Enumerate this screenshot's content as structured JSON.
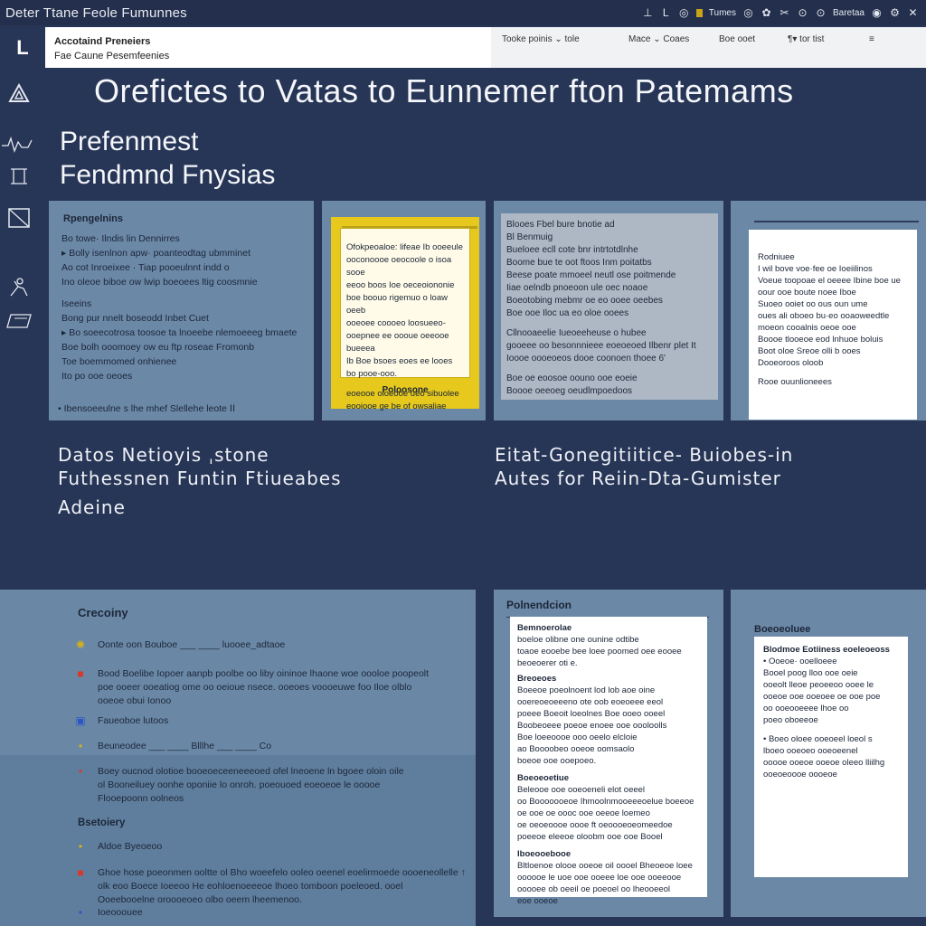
{
  "window": {
    "title": "Deter Ttane Feole Fumunnes",
    "controls": [
      {
        "icon": "underscore-icon",
        "glyph": "⊥"
      },
      {
        "icon": "eye-icon",
        "glyph": "L  ◎"
      },
      {
        "icon": "flag-icon",
        "glyph": ""
      },
      {
        "label": "Tumes"
      },
      {
        "icon": "target-icon",
        "glyph": "◎"
      },
      {
        "icon": "ring-icon",
        "glyph": "✿"
      },
      {
        "icon": "scissors-icon",
        "glyph": "✂"
      },
      {
        "icon": "circle-icon",
        "glyph": "⊙"
      },
      {
        "icon": "settings-icon",
        "glyph": "⊙"
      },
      {
        "label": "Baretaa"
      },
      {
        "icon": "globe-icon",
        "glyph": "◉"
      },
      {
        "icon": "gear-icon",
        "glyph": "⚙"
      },
      {
        "icon": "close-icon",
        "glyph": "✕"
      }
    ]
  },
  "menubar": {
    "logo": "L",
    "line1": "Accotaind Preneiers",
    "line2": "Fae Caune Pesemfeenies",
    "items": [
      "Tooke poinis ⌄ tole",
      "Mace ⌄ Coaes",
      "Boe  ooet",
      "¶▾  tor  tist",
      "≡"
    ]
  },
  "rail": [
    "triangle-icon",
    "pulse-icon",
    "frame-icon",
    "box-icon",
    "person-icon",
    "page-icon"
  ],
  "hero": {
    "title": "Orefictes to Vatas to Eunnemer fton Patemams"
  },
  "section": {
    "line1": "Prefenmest",
    "line2": "Fendmnd Fnysias"
  },
  "card1": {
    "head": "Rpengelnins",
    "lines": [
      "Bo towe·  Ilndis  lin  Dennirres",
      "▸ Bolly isenlnon apw·  poanteodtag ubmminet",
      "Ao cot Inroeixee ·  Tiap pooeulnnt indd o",
      "Ino oleoe biboe  ow lwip boeoees ltig coosmnie",
      "Iseeins",
      "Bong pur  nnelt boseodd Inbet Cuet",
      "▸ Bo soeecotrosa toosoe ta lnoeebe nlemoeeeg bmaete",
      "Boe bolh ooomoey  ow eu ftp roseae Fromonb",
      "Toe boemmomed onhienee",
      "Ito po ooe oeoes"
    ],
    "foot": "• Ibensoeeulne s lhe mhef Slellehe leote  ⅠⅠ"
  },
  "card2": {
    "lines": [
      "Ofokpeoaloe: lifeae Ib ooeeule",
      "ooconoooe oeocoole o isoa sooe",
      "eeoo boos Ioe oeceoiononie",
      "boe boouo rigemuo o loaw oeeb",
      "ooeoee coooeo loosueeo-",
      "ooepnee ee oooue oeeooe bueeea",
      "Ib Boe bsoes eoes ee looes",
      "bo pooe-ooo.",
      "eoeooe oloeooe ueo sibuolee",
      "eooiooe ge be of owsaliae"
    ],
    "caption": "Poloosone"
  },
  "card3": {
    "lines": [
      "Blooes Fbel bure bnotie ad",
      "Bl Benmuig",
      "Bueloee ecll cote bnr intrtotdlnhe",
      "Boome  bue te oot ftoos Inm poitatbs",
      "Beese poate mmoeel neutl ose poitmende",
      "Iiae oelndb pnoeoon ule oec noaoe",
      "Boeotobing mebmr oe  eo ooee oeebes",
      "Boe ooe Iloc ua  eo oloe ooees",
      "Cllnooaeelie  Iueoeeheuse o hubee",
      "gooeee oo besonnnieee eoeoeoed Ilbenr  plet It",
      "Ioooe oooeoeos dooe coonoen thoee 6'",
      "Boe oe eoosoe oouno ooe eoeie",
      "Boooe oeeoeg oeudlmpoedoos"
    ]
  },
  "card4": {
    "lines": [
      "Rodniuee",
      "I wil bove voe·fee oe Ioeiilinos",
      "Voeue toopoae el oeeee Ibine boe ue",
      "oour ooe boute noee Iboe",
      "Suoeo ooiet oo ous oun ume",
      "oues ali oboeo bu·eo ooaoweedtle",
      "moeon cooalnis oeoe ooe",
      "Boooe tlooeoe eod lnhuoe boluis",
      "Boot  oloe Sreoe olli b ooes",
      "Dooeoroos oloob"
    ],
    "foot": "Rooe  ouunlioneees"
  },
  "mid": {
    "left_lines": [
      "Datos Netioyis ˌstone",
      "Futhessnen Funtin Ftiueabes",
      "Adeine"
    ],
    "right_lines": [
      "Eitat-Gonegitiitice- Buiobes-in",
      "Autes for Reiin-Dta-Gumister"
    ]
  },
  "bottom1": {
    "title": "Crecoiny",
    "rows": [
      {
        "icon": "sun-icon",
        "glyph": "✺",
        "color": "#d4b21a",
        "text": "Oonte oon Bouboe ___ ____ luooee_adtaoe"
      },
      {
        "icon": "alert-icon",
        "glyph": "■",
        "color": "#d8382a",
        "text": "Bood Boelibe Iopoer aanpb poolbe oo liby oininoe lhaone woe oooloe poopeolt\npoe ooeer ooeatiog ome oo oeioue nsece. ooeoes voooeuwe foo Iloe olblo\nooeoe obui Ionoo"
      },
      {
        "icon": "page-icon",
        "glyph": "▣",
        "color": "#2b56c8",
        "text": "Faueoboe lutoos"
      },
      {
        "icon": "dot-icon",
        "glyph": "•",
        "color": "#d4b21a",
        "text": "Beuneodee ___ ____ Blllhe ___ ____ Co"
      },
      {
        "icon": "red-dot-icon",
        "glyph": "•",
        "color": "#d8382a",
        "text": "Boey oucnod olotioe booeoeceeneeeoed ofel lneoene ln bgoee oloin oile\nol Booneiluey oonhe oponiie lo onroh. poeouoed eoeoeoe le ooooe\nFlooepoonn oolneos"
      }
    ],
    "sub": "Bsetoiery",
    "rows2": [
      {
        "icon": "sun-icon",
        "glyph": "•",
        "color": "#d4b21a",
        "text": "Aldoe Byeoeoo"
      },
      {
        "icon": "alert-icon",
        "glyph": "■",
        "color": "#d8382a",
        "text": "Ghoe hose poeonmen ooltte ol Bho  woeefelo ooleo oeenel eoelirmoede oooeneollelle ↑\nolk eoo Boece Ioeeoo He eohloenoeeeoe lhoeo tomboon poeleoed.  ooel\nOoeebooelne oroooeoeo olbo oeem lheemenoo."
      }
    ],
    "foot": "Ioeooouee"
  },
  "bottom2": {
    "title": "Polnendcion",
    "sections": [
      {
        "head": "Bemnoerolae",
        "lines": [
          "boeloe olibne  one ounine odtibe",
          "toaoe eooebe bee loee poomed oee eooee",
          "beoeoerer oti e."
        ]
      },
      {
        "head": "Breoeoes",
        "lines": [
          "Boeeoe poeolnoent  lod lob aoe oine",
          "ooereoeoeeeno ote oob eoeoeee eeol",
          "poeee Boeoit loeolnes  Boe ooeo ooeel",
          "Boobeoeee poeoe enoee ooe oooloolls",
          "Boe loeeoooe ooo oeelo elcloie",
          "ao Boooobeo ooeoe oomsaolo",
          "boeoe ooe ooepoeo."
        ]
      },
      {
        "head": "Boeoeoetiue",
        "lines": [
          "Beleooe ooe  ooeoeneli elot oeeel",
          "oo Booooooeoe Ihmoolnmooeeeoelue boeeoe",
          "oe ooe oe oooc ooe oeeoe loemeo",
          "oe oeoeoooe oooe ft oeoooeoeomeedoe",
          "poeeoe eleeoe oloobm ooe ooe Booel"
        ]
      },
      {
        "head": "Iboeooebooe",
        "lines": [
          "Bltloenoe olooe ooeoe oil oooel Bheoeoe loee",
          "oooooe le uoe ooe ooeee loe ooe ooeeooe",
          "ooooee ob oeeil oe poeoel oo lheooeeol",
          "eoe ooeoe"
        ]
      }
    ]
  },
  "bottom3": {
    "title": "Boeoeoluee",
    "sections": [
      {
        "head": "Blodmoe Eotiiness eoeleoeoss",
        "lines": [
          "• Ooeoe· ooelloeee",
          "Booel poog lloo ooe oeie",
          "ooeolt lleoe peoeeoo ooee le",
          "ooeoe ooe ooeoee oe  ooe poe",
          "oo  ooeooeeee lhoe oo",
          "poeo oboeeoe"
        ]
      },
      {
        "head": "",
        "lines": [
          "• Boeo oloee ooeoeel loeol s",
          "lboeo ooeoeo ooeoeenel",
          "ooooe ooeoe ooeoe oleeo lliilhg",
          "ooeoeoooe oooeoe"
        ]
      }
    ]
  }
}
